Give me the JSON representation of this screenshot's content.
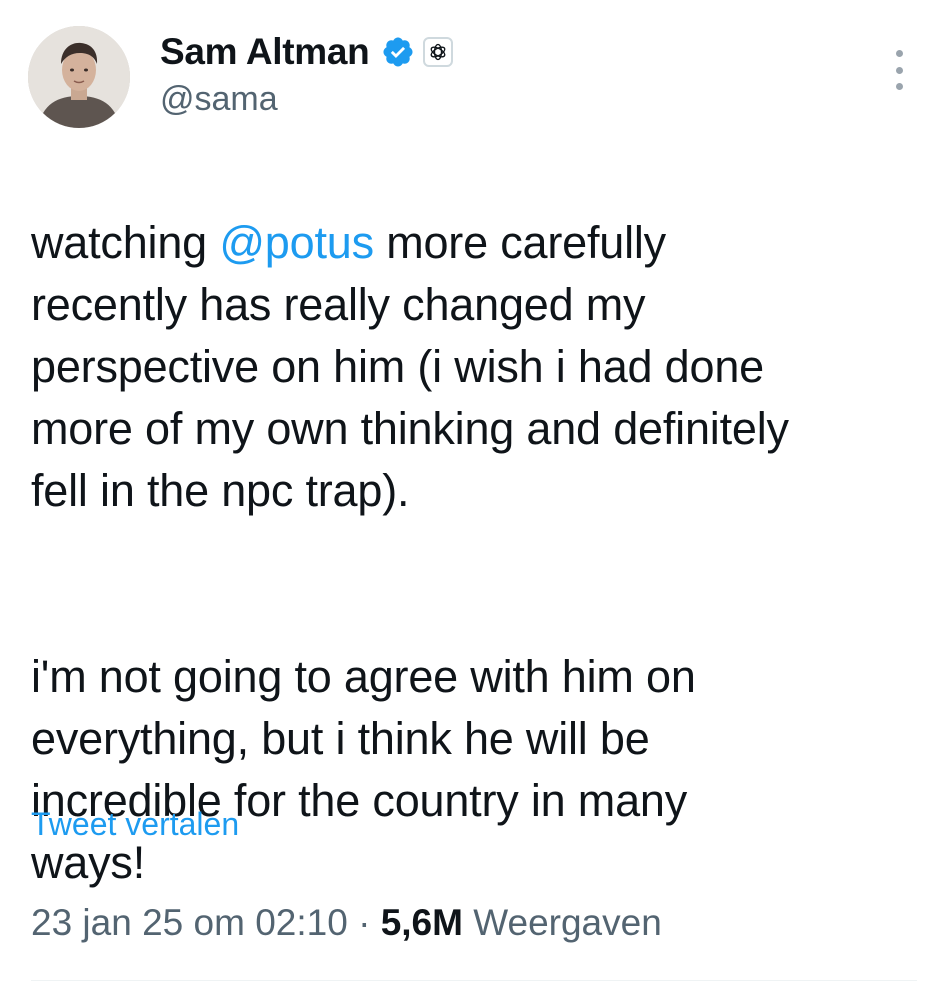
{
  "author": {
    "display_name": "Sam Altman",
    "handle": "@sama",
    "verified": true,
    "affiliate_badge_icon": "openai-logo-icon",
    "verified_color": "#1d9bf0"
  },
  "tweet": {
    "paragraph_1": {
      "before_mention": "watching ",
      "mention": "@potus",
      "after_mention": " more carefully\nrecently has really changed my\nperspective on him (i wish i had done\nmore of my own thinking and definitely\nfell in the npc trap)."
    },
    "paragraph_2": "i'm not going to agree with him on\neverything, but i think he will be\nincredible for the country in many\nways!"
  },
  "translate_label": "Tweet vertalen",
  "meta": {
    "timestamp": "23 jan 25 om 02:10",
    "separator": " · ",
    "views_count": "5,6M",
    "views_label": " Weergaven"
  },
  "colors": {
    "link": "#1d9bf0",
    "secondary_text": "#536471",
    "primary_text": "#0f1419"
  }
}
